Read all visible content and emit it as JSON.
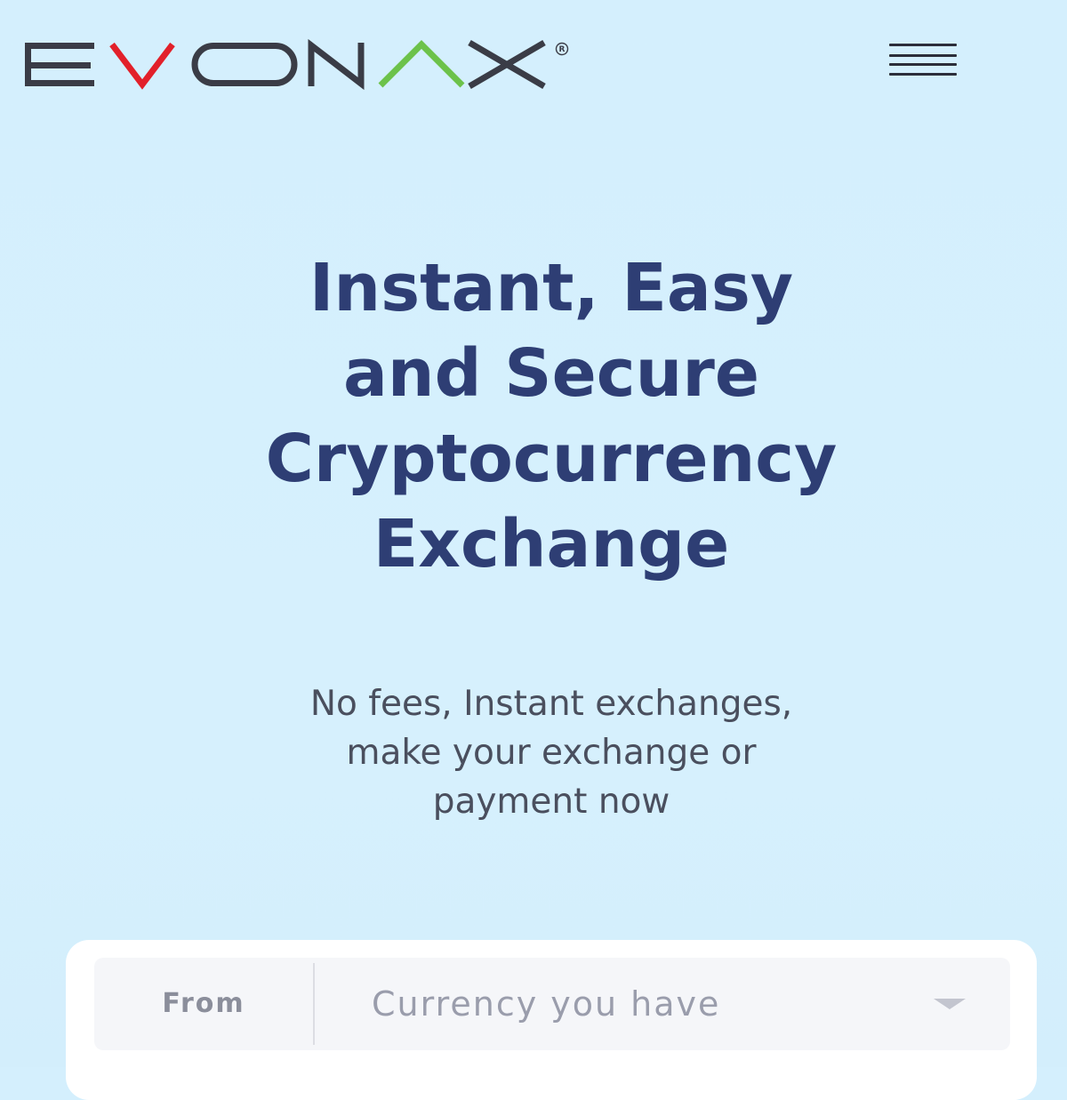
{
  "header": {
    "logo": {
      "letters": [
        "E",
        "V",
        "O",
        "N",
        "A",
        "X"
      ],
      "registered": "®",
      "colors": {
        "dark": "#3a3c46",
        "v_red": "#e2202a",
        "a_green": "#6cc24a"
      }
    },
    "menu_icon": "hamburger-menu-icon"
  },
  "hero": {
    "title_lines": [
      "Instant, Easy",
      "and Secure",
      "Cryptocurrency",
      "Exchange"
    ],
    "subtitle_lines": [
      "No fees, Instant exchanges,",
      "make your exchange or",
      "payment now"
    ],
    "title_color": "#2e3e74"
  },
  "exchange_form": {
    "from_label": "From",
    "currency_placeholder": "Currency you have",
    "caret_icon": "chevron-down-icon"
  }
}
